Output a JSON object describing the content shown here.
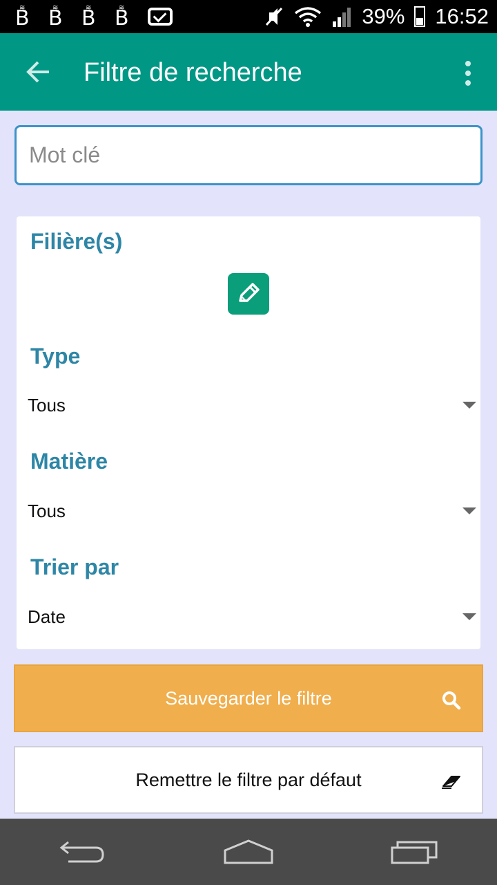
{
  "status_bar": {
    "notification_icons": [
      "b-icon",
      "b-icon",
      "b-icon",
      "b-icon",
      "mail-icon"
    ],
    "battery": "39%",
    "time": "16:52"
  },
  "app_bar": {
    "title": "Filtre de recherche",
    "back_icon": "arrow-left-icon",
    "menu_icon": "more-vertical-icon"
  },
  "search": {
    "placeholder": "Mot clé",
    "value": ""
  },
  "filters": {
    "filieres_title": "Filière(s)",
    "edit_icon": "pencil-icon",
    "type_title": "Type",
    "type_value": "Tous",
    "matiere_title": "Matière",
    "matiere_value": "Tous",
    "sort_title": "Trier par",
    "sort_value": "Date"
  },
  "actions": {
    "save_label": "Sauvegarder le filtre",
    "save_icon": "search-icon",
    "reset_label": "Remettre le filtre par défaut",
    "reset_icon": "eraser-icon"
  },
  "colors": {
    "app_bar": "#009785",
    "title_text": "#2e86a6",
    "save_button": "#f0ae4c",
    "edit_button": "#0a9e7a",
    "background": "#e3e3fb"
  },
  "nav_bar": {
    "icons": [
      "back-icon",
      "home-icon",
      "recents-icon"
    ]
  }
}
